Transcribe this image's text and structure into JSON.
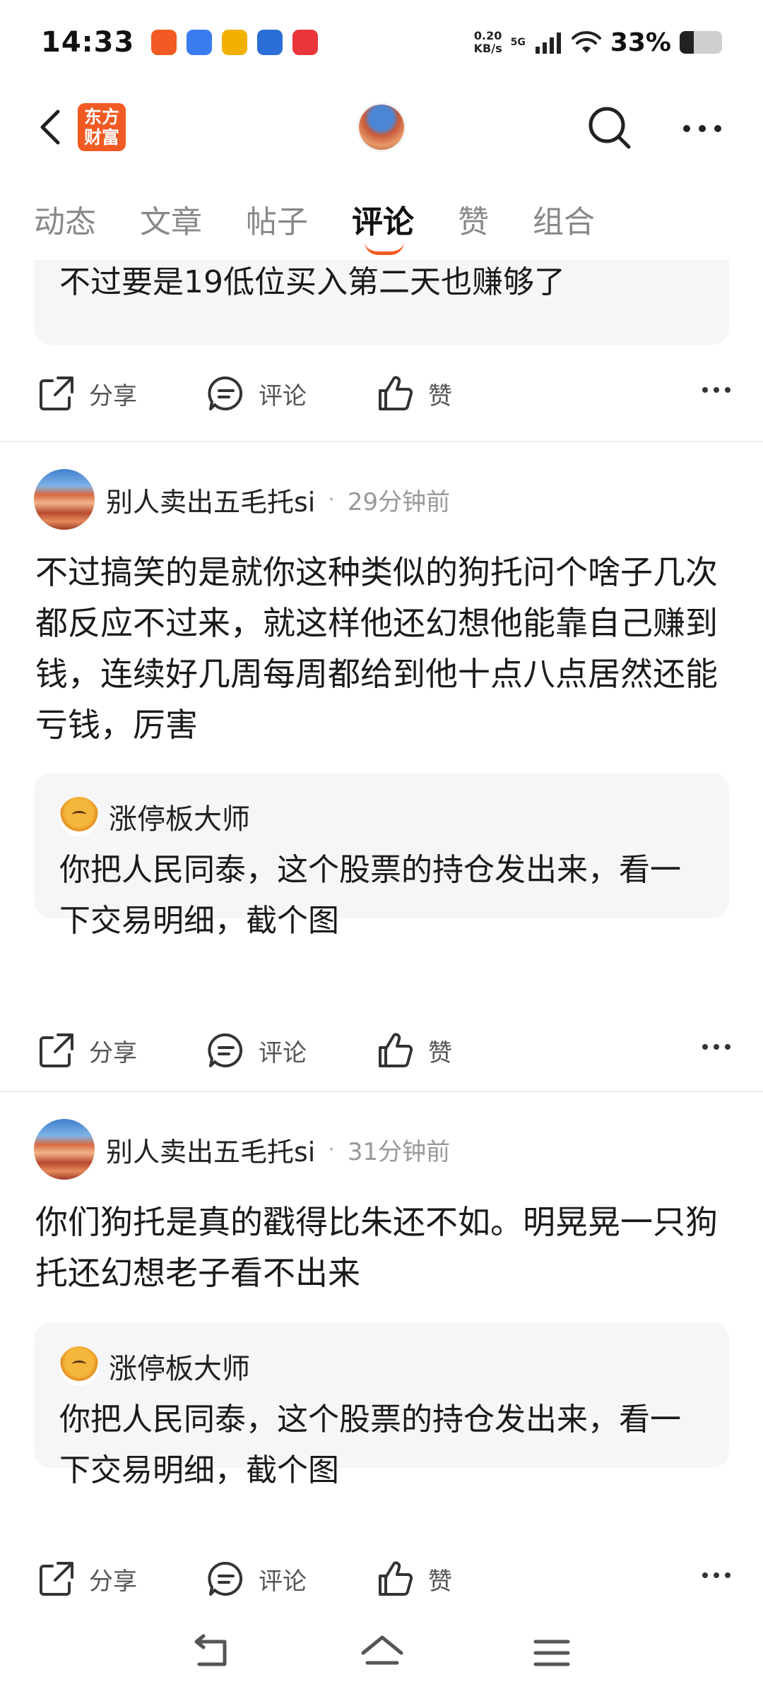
{
  "status_bar": {
    "time": "14:33",
    "net_speed_value": "0.20",
    "net_speed_unit": "KB/s",
    "network": "5G",
    "battery_text": "33%",
    "battery_level": 0.33,
    "app_icons": [
      {
        "name": "app-notification-icon",
        "color": "#f15a22"
      },
      {
        "name": "app-notification-icon",
        "color": "#3a7cf0"
      },
      {
        "name": "app-notification-icon",
        "color": "#f2b000"
      },
      {
        "name": "app-notification-icon",
        "color": "#2b6fd6"
      },
      {
        "name": "app-notification-icon",
        "color": "#e8363b"
      }
    ]
  },
  "header": {
    "logo_line1": "东方",
    "logo_line2": "财富",
    "logo_color": "#f15a22"
  },
  "tabs": [
    {
      "label": "动态",
      "active": false
    },
    {
      "label": "文章",
      "active": false
    },
    {
      "label": "帖子",
      "active": false
    },
    {
      "label": "评论",
      "active": true
    },
    {
      "label": "赞",
      "active": false
    },
    {
      "label": "组合",
      "active": false
    }
  ],
  "first_item": {
    "quote_text": "不过要是19低位买入第二天也赚够了"
  },
  "actions": {
    "share": "分享",
    "comment": "评论",
    "like": "赞"
  },
  "posts": [
    {
      "author": "别人卖出五毛托si",
      "separator": "·",
      "time": "29分钟前",
      "body": "不过搞笑的是就你这种类似的狗托问个啥子几次都反应不过来，就这样他还幻想他能靠自己赚到钱，连续好几周每周都给到他十点八点居然还能亏钱，厉害",
      "quote_author": "涨停板大师",
      "quote_text": "你把人民同泰，这个股票的持仓发出来，看一下交易明细，截个图"
    },
    {
      "author": "别人卖出五毛托si",
      "separator": "·",
      "time": "31分钟前",
      "body": "你们狗托是真的戳得比朱还不如。明晃晃一只狗托还幻想老子看不出来",
      "quote_author": "涨停板大师",
      "quote_text": "你把人民同泰，这个股票的持仓发出来，看一下交易明细，截个图"
    }
  ],
  "colors": {
    "accent": "#f15a22",
    "card_bg": "#f6f6f8",
    "divider": "#ececec"
  }
}
